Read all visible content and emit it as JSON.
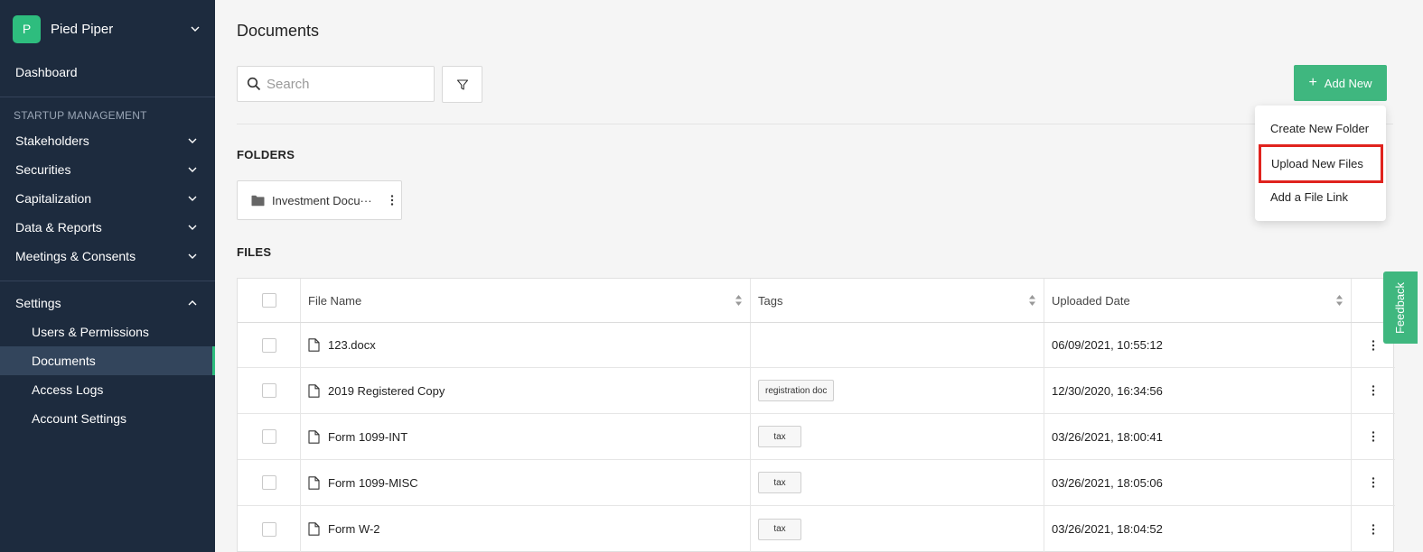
{
  "org": {
    "initial": "P",
    "name": "Pied Piper"
  },
  "nav": {
    "dashboard": "Dashboard",
    "section_title": "STARTUP MANAGEMENT",
    "groups": [
      "Stakeholders",
      "Securities",
      "Capitalization",
      "Data & Reports",
      "Meetings & Consents"
    ],
    "settings": "Settings",
    "settings_items": [
      "Users & Permissions",
      "Documents",
      "Access Logs",
      "Account Settings"
    ],
    "active_item": "Documents"
  },
  "page": {
    "title": "Documents",
    "search_placeholder": "Search",
    "add_button": "Add New",
    "folders_heading": "FOLDERS",
    "files_heading": "FILES"
  },
  "folders": [
    {
      "name": "Investment Docu···"
    }
  ],
  "dropdown": {
    "items": [
      "Create New Folder",
      "Upload New Files",
      "Add a File Link"
    ],
    "highlighted": "Upload New Files"
  },
  "table": {
    "columns": [
      "File Name",
      "Tags",
      "Uploaded Date"
    ],
    "rows": [
      {
        "name": "123.docx",
        "tag": "",
        "date": "06/09/2021, 10:55:12"
      },
      {
        "name": "2019 Registered Copy",
        "tag": "registration doc",
        "date": "12/30/2020, 16:34:56"
      },
      {
        "name": "Form 1099-INT",
        "tag": "tax",
        "date": "03/26/2021, 18:00:41"
      },
      {
        "name": "Form 1099-MISC",
        "tag": "tax",
        "date": "03/26/2021, 18:05:06"
      },
      {
        "name": "Form W-2",
        "tag": "tax",
        "date": "03/26/2021, 18:04:52"
      }
    ]
  },
  "feedback": "Feedback",
  "colors": {
    "sidebar": "#1d2b3e",
    "accent": "#2ebd7e",
    "button": "#3fb77f",
    "highlight": "#e0231e"
  },
  "icons": [
    "chevron-down-icon",
    "chevron-up-icon",
    "search-icon",
    "filter-icon",
    "plus-icon",
    "folder-icon",
    "kebab-icon",
    "file-icon",
    "sort-icon"
  ]
}
